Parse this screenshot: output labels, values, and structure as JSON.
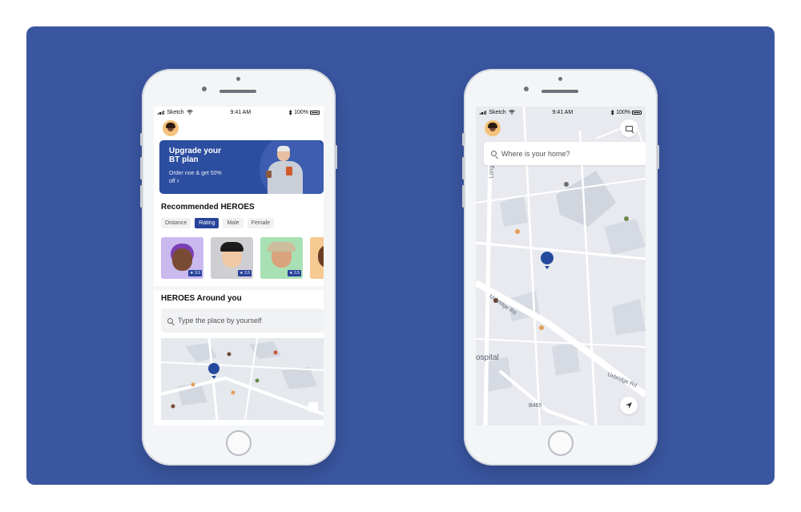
{
  "left_phone": {
    "status": {
      "carrier": "Sketch",
      "time": "9:41 AM",
      "battery": "100%"
    },
    "banner": {
      "title": "Upgrade your BT plan",
      "subtitle": "Order noe & get 50% off",
      "chevron": "›"
    },
    "recommended": {
      "heading": "Recommended HEROES",
      "filters": [
        "Distance",
        "Rating",
        "Male",
        "Female"
      ],
      "active_filter": "Rating",
      "heroes": [
        {
          "rating": "★ 3.5",
          "bg": "#c9b9ef"
        },
        {
          "rating": "★ 3.5",
          "bg": "#cfcfd3"
        },
        {
          "rating": "★ 3.5",
          "bg": "#a9e0b3"
        },
        {
          "rating": "",
          "bg": "#f6c992"
        }
      ]
    },
    "around": {
      "heading": "HEROES Around you",
      "search_placeholder": "Type the place by yourself"
    }
  },
  "right_phone": {
    "status": {
      "carrier": "Sketch",
      "time": "9:41 AM",
      "battery": "100%"
    },
    "search_placeholder": "Where is your home?",
    "map_labels": {
      "road1": "Uxbridge Rd",
      "road2": "Uxbridge Rd",
      "road3": "B465",
      "place": "ospital",
      "long": "Long"
    }
  },
  "colors": {
    "background": "#3a56a0",
    "accent": "#27439a",
    "pin": "#244a9e"
  },
  "icons": [
    "signal-icon",
    "wifi-icon",
    "bluetooth-icon",
    "battery-icon",
    "search-icon",
    "expand-icon",
    "navigate-icon",
    "location-pin-icon"
  ]
}
